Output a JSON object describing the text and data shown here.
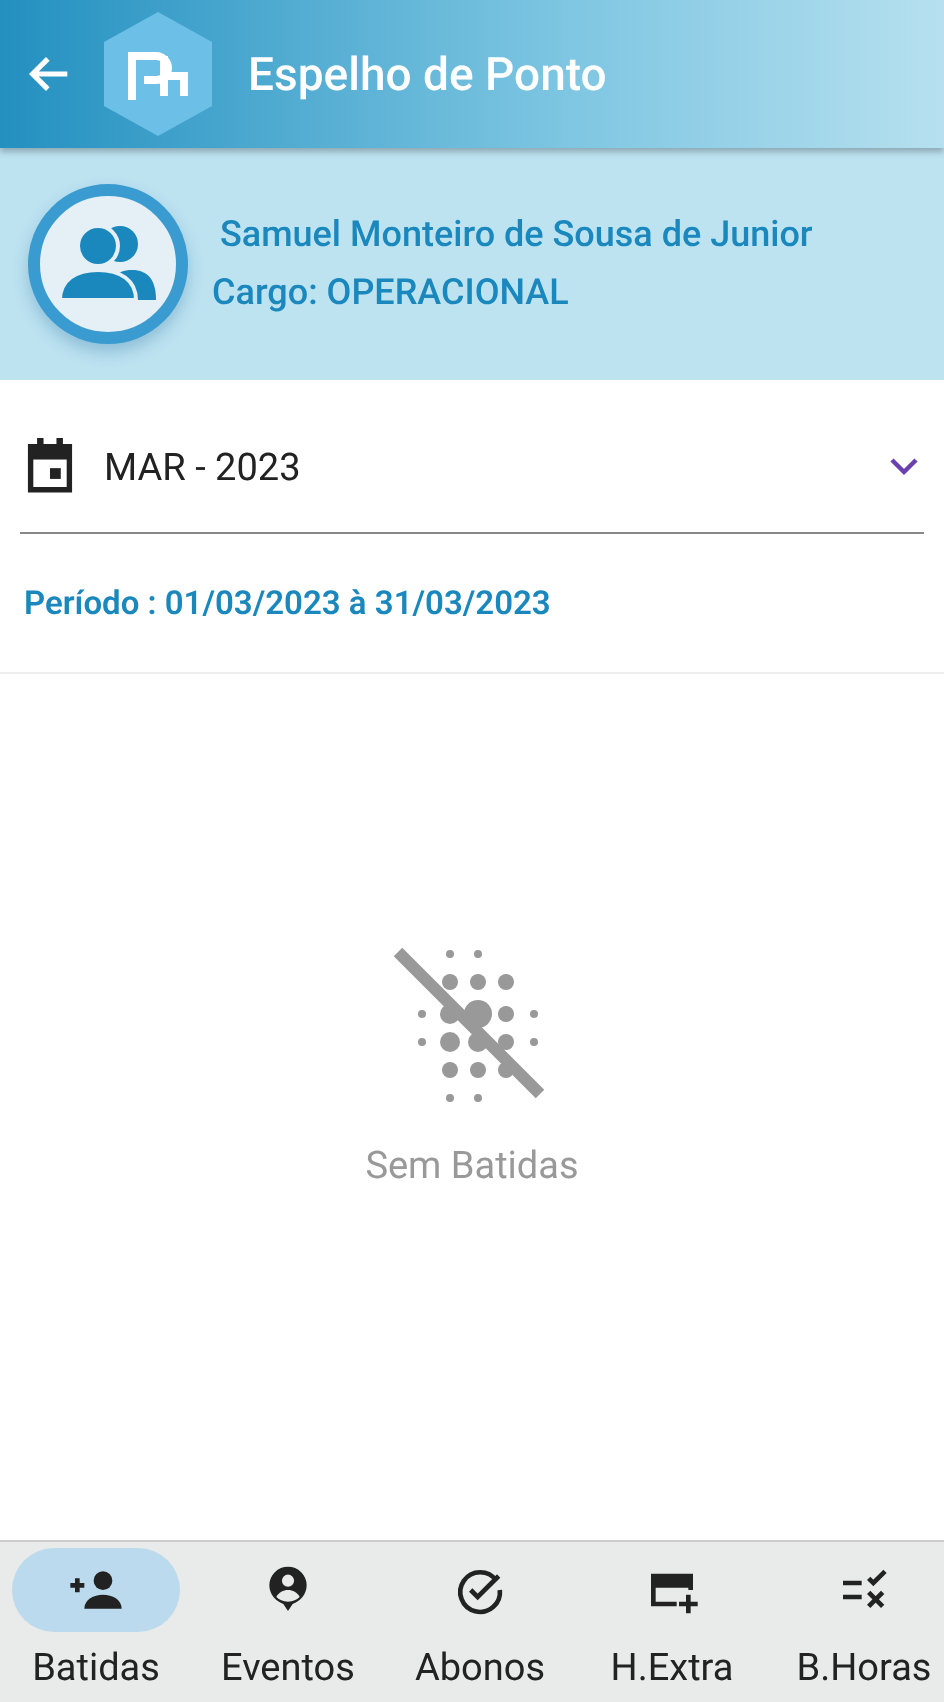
{
  "app_bar": {
    "title": "Espelho de Ponto"
  },
  "employee": {
    "name": "Samuel Monteiro de Sousa de Junior",
    "role": "Cargo: OPERACIONAL"
  },
  "month_select": {
    "value": "MAR - 2023"
  },
  "period": "Período : 01/03/2023 à 31/03/2023",
  "empty_state": {
    "message": "Sem Batidas"
  },
  "bottom_nav": [
    {
      "kind": "person-add",
      "label": "Batidas",
      "selected": true
    },
    {
      "kind": "person-pin",
      "label": "Eventos",
      "selected": false
    },
    {
      "kind": "check-circle",
      "label": "Abonos",
      "selected": false
    },
    {
      "kind": "card-add",
      "label": "H.Extra",
      "selected": false
    },
    {
      "kind": "list-check",
      "label": "B.Horas",
      "selected": false
    }
  ]
}
